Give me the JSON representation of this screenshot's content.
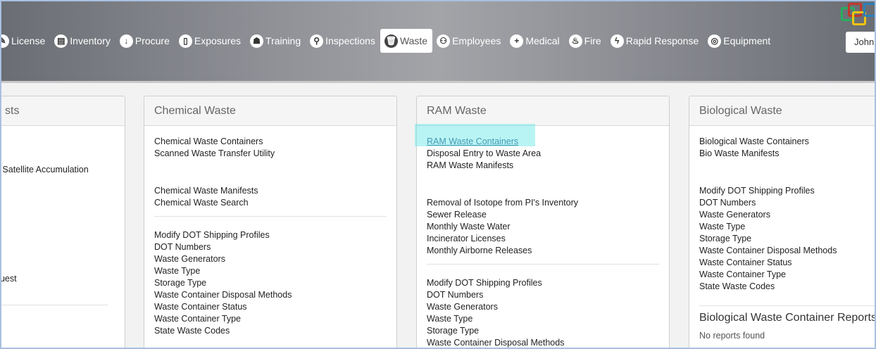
{
  "nav": {
    "items": [
      {
        "name": "nav-license",
        "label": "License",
        "icon": "license-icon",
        "glyph": "✎"
      },
      {
        "name": "nav-inventory",
        "label": "Inventory",
        "icon": "inventory-icon",
        "glyph": "▤"
      },
      {
        "name": "nav-procure",
        "label": "Procure",
        "icon": "procure-icon",
        "glyph": "↓"
      },
      {
        "name": "nav-exposures",
        "label": "Exposures",
        "icon": "exposures-icon",
        "glyph": "▯"
      },
      {
        "name": "nav-training",
        "label": "Training",
        "icon": "training-icon",
        "glyph": "☗"
      },
      {
        "name": "nav-inspections",
        "label": "Inspections",
        "icon": "inspections-icon",
        "glyph": "⚲"
      },
      {
        "name": "nav-waste",
        "label": "Waste",
        "icon": "waste-icon",
        "glyph": "🗑",
        "active": true
      },
      {
        "name": "nav-employees",
        "label": "Employees",
        "icon": "employees-icon",
        "glyph": "⚇"
      },
      {
        "name": "nav-medical",
        "label": "Medical",
        "icon": "medical-icon",
        "glyph": "+"
      },
      {
        "name": "nav-fire",
        "label": "Fire",
        "icon": "fire-icon",
        "glyph": "♨"
      },
      {
        "name": "nav-rapid-response",
        "label": "Rapid Response",
        "icon": "rapid-response-icon",
        "glyph": "ϟ"
      },
      {
        "name": "nav-equipment",
        "label": "Equipment",
        "icon": "equipment-icon",
        "glyph": "◎"
      }
    ],
    "user_label": "John"
  },
  "left_panel": {
    "title": "sts",
    "lines": [
      "g Satellite Accumulation",
      "quest"
    ]
  },
  "chemical": {
    "title": "Chemical Waste",
    "group1": [
      "Chemical Waste Containers",
      "Scanned Waste Transfer Utility"
    ],
    "group2": [
      "Chemical Waste Manifests",
      "Chemical Waste Search"
    ],
    "group3": [
      "Modify DOT Shipping Profiles",
      "DOT Numbers",
      "Waste Generators",
      "Waste Type",
      "Storage Type",
      "Waste Container Disposal Methods",
      "Waste Container Status",
      "Waste Container Type",
      "State Waste Codes"
    ]
  },
  "ram": {
    "title": "RAM Waste",
    "group1": [
      "RAM Waste Containers",
      "Disposal Entry to Waste Area",
      "RAM Waste Manifests"
    ],
    "group2": [
      "Removal of Isotope from PI's Inventory",
      "Sewer Release",
      "Monthly Waste Water",
      "Incinerator Licenses",
      "Monthly Airborne Releases"
    ],
    "group3": [
      "Modify DOT Shipping Profiles",
      "DOT Numbers",
      "Waste Generators",
      "Waste Type",
      "Storage Type",
      "Waste Container Disposal Methods"
    ]
  },
  "bio": {
    "title": "Biological Waste",
    "group1": [
      "Biological Waste Containers",
      "Bio Waste Manifests"
    ],
    "group2": [
      "Modify DOT Shipping Profiles",
      "DOT Numbers",
      "Waste Generators",
      "Waste Type",
      "Storage Type",
      "Waste Container Disposal Methods",
      "Waste Container Status",
      "Waste Container Type",
      "State Waste Codes"
    ],
    "reports_title": "Biological Waste Container Reports",
    "reports_empty": "No reports found"
  },
  "colors": {
    "accent": "#2b5a8a",
    "highlight": "#64e6e6",
    "logo_red": "#c0392b",
    "logo_yellow": "#f1c40f",
    "logo_green": "#27ae60",
    "logo_blue": "#2980b9"
  }
}
